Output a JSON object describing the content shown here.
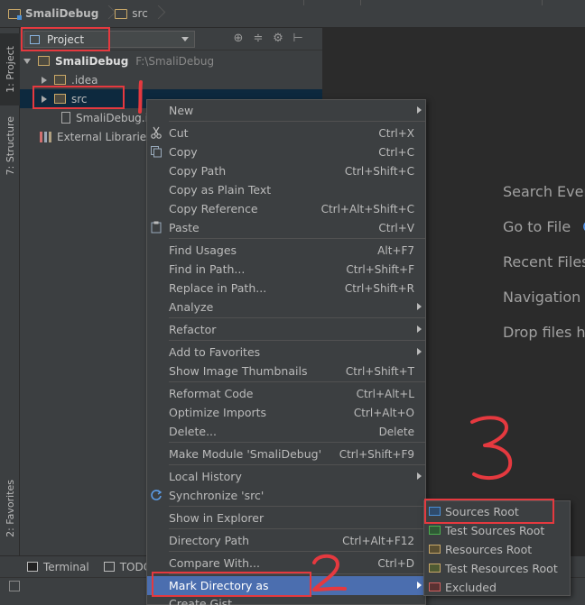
{
  "navbar": {
    "project_name": "SmaliDebug",
    "folder_name": "src"
  },
  "tool_stripe": {
    "project_tab": "1: Project",
    "structure_tab": "7: Structure",
    "favorites_tab": "2: Favorites"
  },
  "project_panel": {
    "view_selector": "Project",
    "tree": [
      {
        "label": "SmaliDebug",
        "path": "F:\\SmaliDebug"
      },
      {
        "label": ".idea"
      },
      {
        "label": "src"
      },
      {
        "label": "SmaliDebug.iml"
      },
      {
        "label": "External Libraries"
      }
    ]
  },
  "editor_hints": [
    "Search Every",
    "Go to File",
    "Recent Files",
    "Navigation B",
    "Drop files he"
  ],
  "bottom_bar": {
    "terminal": "Terminal",
    "todo": "TODO"
  },
  "context_menu": {
    "new": "New",
    "cut": "Cut",
    "cut_sc": "Ctrl+X",
    "copy": "Copy",
    "copy_sc": "Ctrl+C",
    "copy_path": "Copy Path",
    "copy_path_sc": "Ctrl+Shift+C",
    "copy_plain": "Copy as Plain Text",
    "copy_ref": "Copy Reference",
    "copy_ref_sc": "Ctrl+Alt+Shift+C",
    "paste": "Paste",
    "paste_sc": "Ctrl+V",
    "find_usages": "Find Usages",
    "find_usages_sc": "Alt+F7",
    "find_in_path": "Find in Path...",
    "find_in_path_sc": "Ctrl+Shift+F",
    "replace_in_path": "Replace in Path...",
    "replace_in_path_sc": "Ctrl+Shift+R",
    "analyze": "Analyze",
    "refactor": "Refactor",
    "add_favorites": "Add to Favorites",
    "show_thumbs": "Show Image Thumbnails",
    "show_thumbs_sc": "Ctrl+Shift+T",
    "reformat": "Reformat Code",
    "reformat_sc": "Ctrl+Alt+L",
    "optimize": "Optimize Imports",
    "optimize_sc": "Ctrl+Alt+O",
    "delete": "Delete...",
    "delete_sc": "Delete",
    "make_module": "Make Module 'SmaliDebug'",
    "make_module_sc": "Ctrl+Shift+F9",
    "local_history": "Local History",
    "synchronize": "Synchronize 'src'",
    "show_explorer": "Show in Explorer",
    "dir_path": "Directory Path",
    "dir_path_sc": "Ctrl+Alt+F12",
    "compare": "Compare With...",
    "compare_sc": "Ctrl+D",
    "mark_dir": "Mark Directory as",
    "create_gist": "Create Gist..."
  },
  "submenu": {
    "sources_root": "Sources Root",
    "test_sources_root": "Test Sources Root",
    "resources_root": "Resources Root",
    "test_resources_root": "Test Resources Root",
    "excluded": "Excluded"
  },
  "colors": {
    "highlight": "#4b6eaf",
    "annotation": "#e5393f",
    "folder_source": "#4a8fd6",
    "folder_test": "#4caf50",
    "folder_resource": "#c9a868",
    "folder_excluded": "#d06060"
  }
}
